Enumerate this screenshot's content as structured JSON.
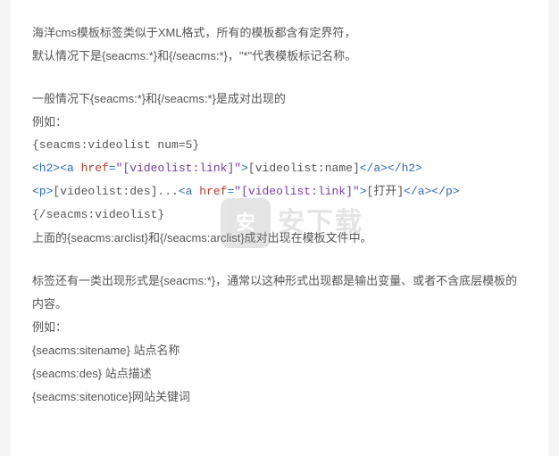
{
  "intro": {
    "l1": "海洋cms模板标签类似于XML格式，所有的模板都含有定界符，",
    "l2": "默认情况下是{seacms:*}和{/seacms:*}，\"*\"代表模板标记名称。"
  },
  "general": {
    "l1": "一般情况下{seacms:*}和{/seacms:*}是成对出现的",
    "l2": "例如：",
    "l3": "{seacms:videolist num=5}",
    "code1": {
      "t_open_h2": "<h2>",
      "t_open_a": "<a ",
      "attr_href": "href",
      "eq": "=",
      "q1": "\"",
      "val_link": "[videolist:link]",
      "q2": "\"",
      "t_close_a_open": ">",
      "name_text": "[videolist:name]",
      "t_a_close": "</a>",
      "t_h2_close": "</h2>"
    },
    "code2": {
      "t_p_open": "<p>",
      "des_text": "[videolist:des]...",
      "t_open_a": "<a ",
      "attr_href": "href",
      "eq": "=",
      "q1": "\"",
      "val_link": "[videolist:link]",
      "q2": "\"",
      "t_close_a_open": ">",
      "open_text": "[打开]",
      "t_a_close": "</a>",
      "t_p_close": "</p>"
    },
    "l4": "{/seacms:videolist}",
    "l5": "上面的{seacms:arclist}和{/seacms:arclist}成对出现在模板文件中。"
  },
  "single": {
    "l1": "标签还有一类出现形式是{seacms:*}，通常以这种形式出现都是输出变量、或者不含底层模板的内容。",
    "l2": "例如：",
    "l3": "{seacms:sitename} 站点名称",
    "l4": "{seacms:des} 站点描述",
    "l5": "{seacms:sitenotice}网站关键词"
  },
  "watermark": {
    "badge": "安",
    "text": "安下载"
  }
}
